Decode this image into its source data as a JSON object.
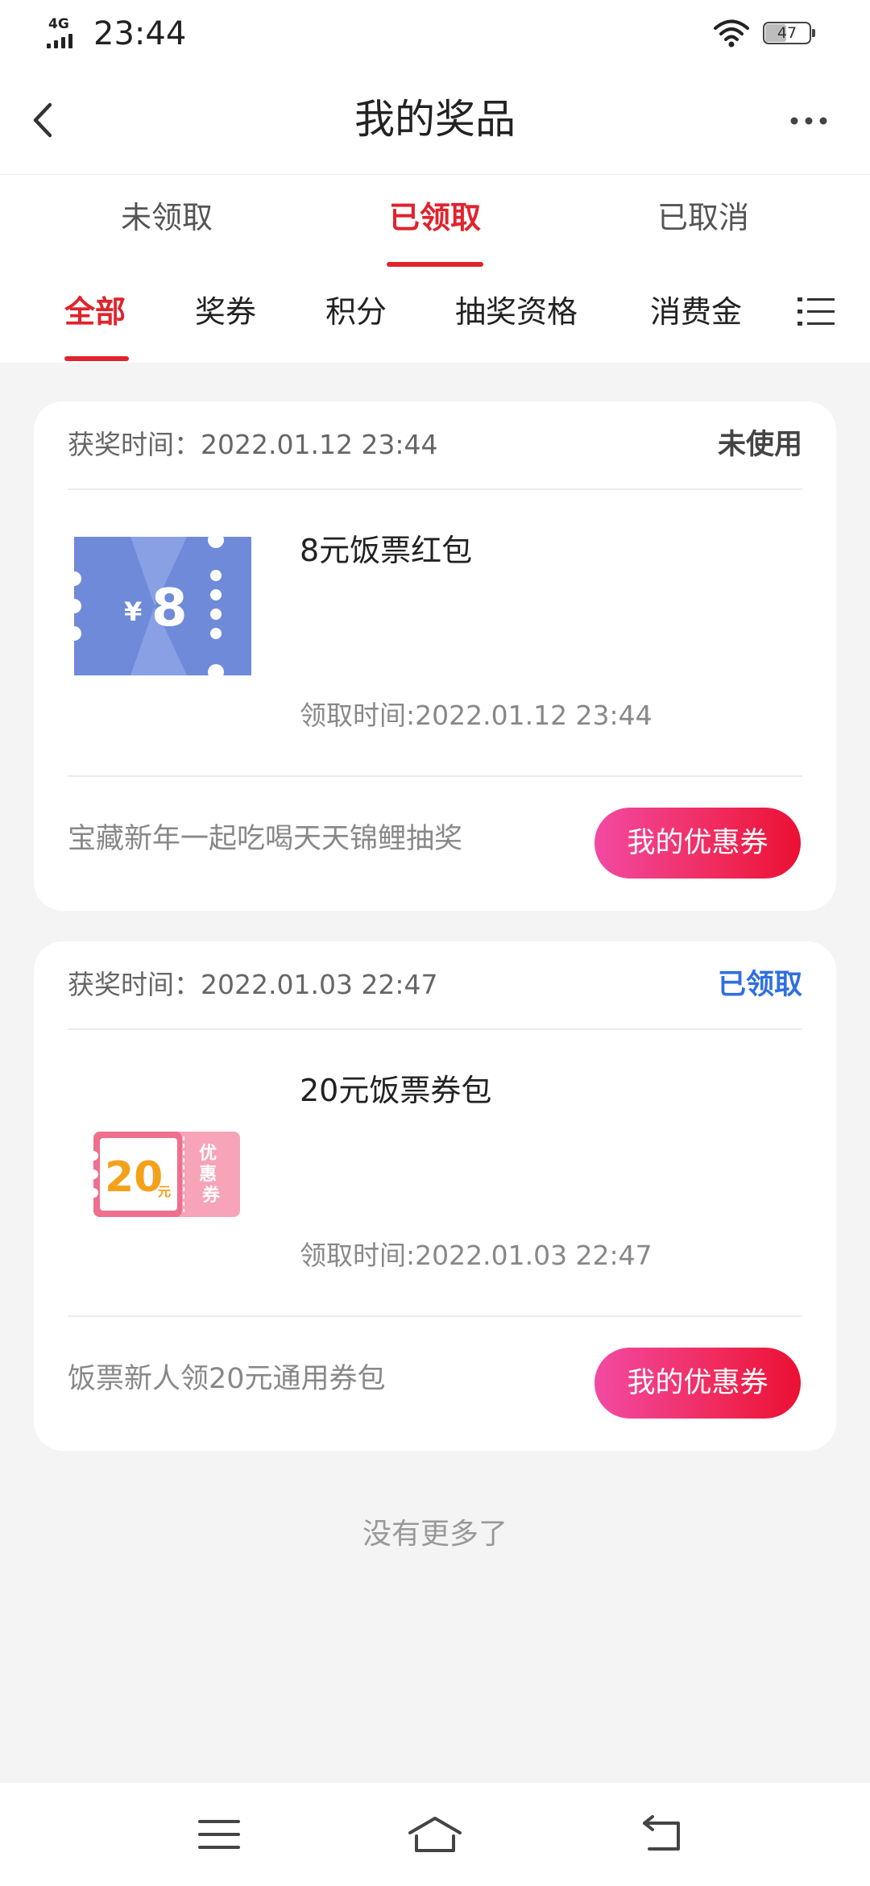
{
  "status_bar": {
    "network": "4G",
    "time": "23:44",
    "battery": "47"
  },
  "header": {
    "title": "我的奖品"
  },
  "status_tabs": [
    {
      "label": "未领取"
    },
    {
      "label": "已领取"
    },
    {
      "label": "已取消"
    }
  ],
  "category_tabs": [
    {
      "label": "全部"
    },
    {
      "label": "奖券"
    },
    {
      "label": "积分"
    },
    {
      "label": "抽奖资格"
    },
    {
      "label": "消费金"
    }
  ],
  "prizes": [
    {
      "award_time": "获奖时间：2022.01.12 23:44",
      "status": "未使用",
      "status_color": "#444444",
      "thumb_symbol": "¥",
      "thumb_amount": "8",
      "name": "8元饭票红包",
      "claim_time": "领取时间:2022.01.12 23:44",
      "activity": "宝藏新年一起吃喝天天锦鲤抽奖",
      "button": "我的优惠券"
    },
    {
      "award_time": "获奖时间：2022.01.03 22:47",
      "status": "已领取",
      "status_color": "#2f6fe0",
      "thumb_amount": "20",
      "thumb_unit": "元",
      "thumb_side": "优惠券",
      "name": "20元饭票券包",
      "claim_time": "领取时间:2022.01.03 22:47",
      "activity": "饭票新人领20元通用券包",
      "button": "我的优惠券"
    }
  ],
  "footer": {
    "no_more": "没有更多了"
  },
  "colors": {
    "accent": "#e0232c",
    "button_gradient_start": "#f24aa3",
    "button_gradient_end": "#eb1033"
  }
}
